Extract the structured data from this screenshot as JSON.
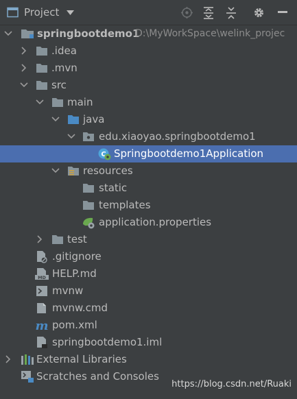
{
  "header": {
    "title": "Project",
    "view_dropdown_icon": "caret-down-icon",
    "toolbar_icons": [
      "locate-icon",
      "expand-all-icon",
      "collapse-all-icon",
      "gear-icon",
      "hide-icon"
    ]
  },
  "tree": {
    "root": {
      "label": "springbootdemo1",
      "path": "D:\\MyWorkSpace\\welink_projec"
    },
    "idea": "idea",
    "idea_prefix": ".",
    "mvn_folder": ".mvn",
    "src": "src",
    "main": "main",
    "java": "java",
    "package": "edu.xiaoyao.springbootdemo1",
    "app_class": "Springbootdemo1Application",
    "resources": "resources",
    "static": "static",
    "templates": "templates",
    "app_properties": "application.properties",
    "test": "test",
    "gitignore": ".gitignore",
    "help_md": "HELP.md",
    "mvnw": "mvnw",
    "mvnw_cmd": "mvnw.cmd",
    "pom_xml": "pom.xml",
    "iml": "springbootdemo1.iml",
    "external_libraries": "External Libraries",
    "scratches": "Scratches and Consoles"
  },
  "colors": {
    "background": "#3c3f41",
    "selection": "#4b6eaf",
    "text": "#bbbbbb",
    "folder": "#87939a",
    "source_folder": "#4a8ac4"
  },
  "watermark": "https://blog.csdn.net/Ruaki"
}
